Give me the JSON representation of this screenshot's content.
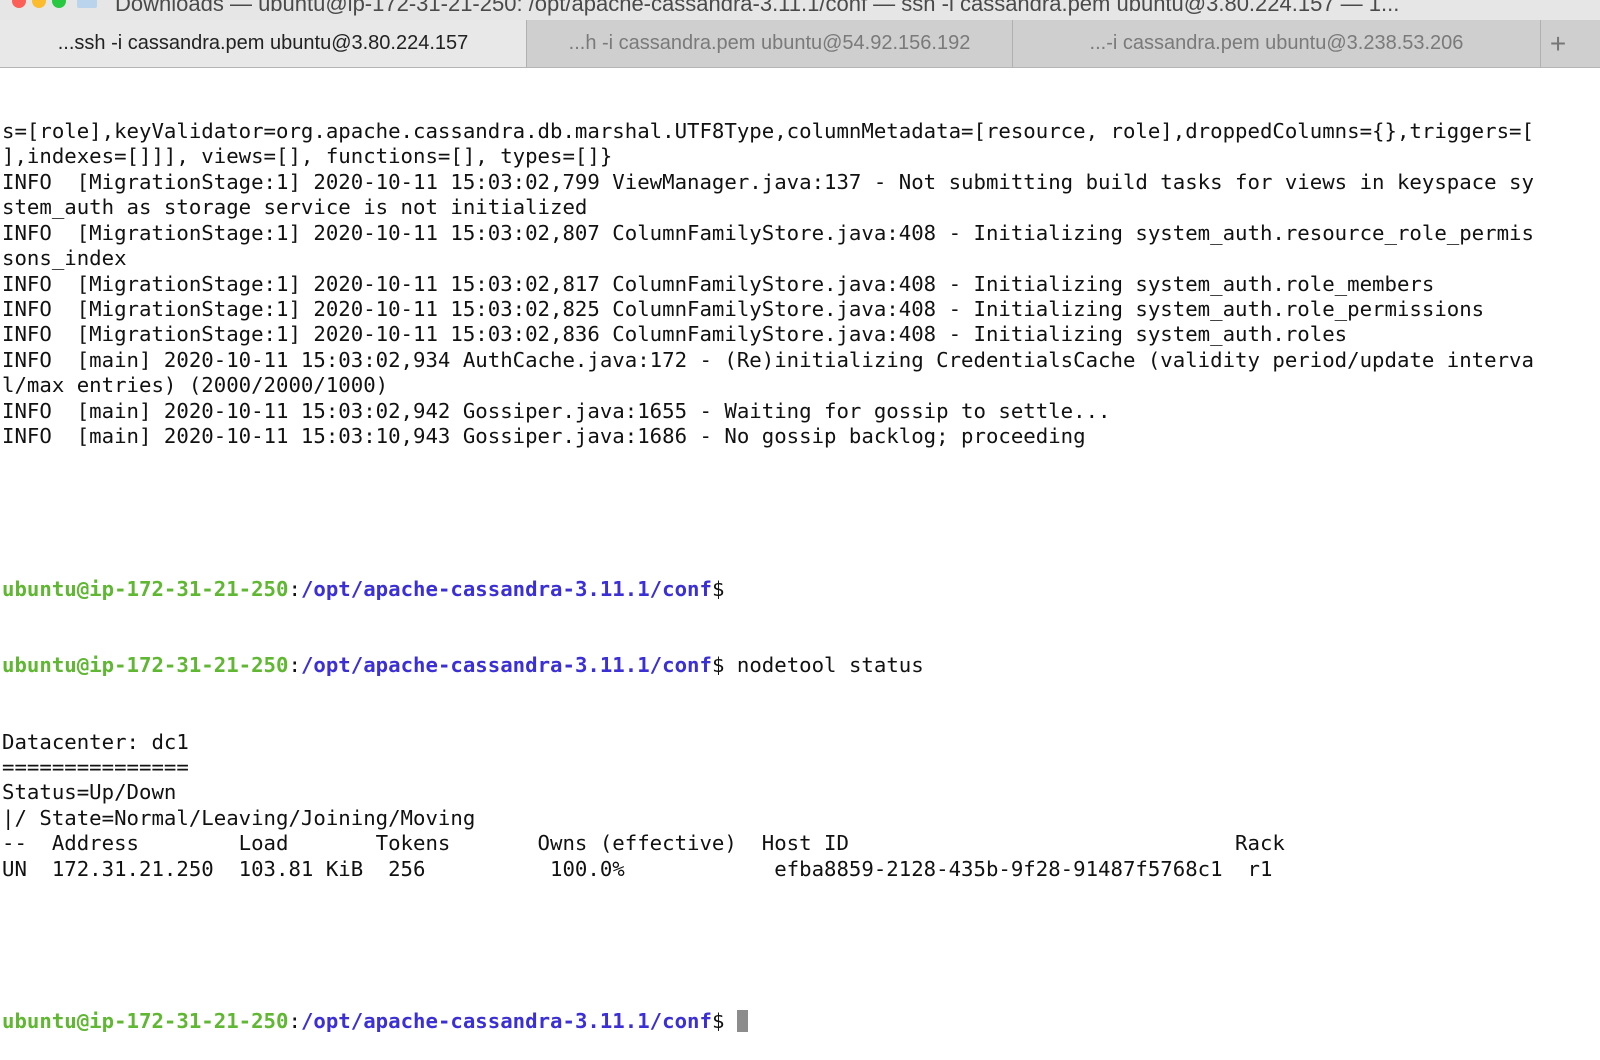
{
  "window": {
    "title": "Downloads — ubuntu@ip-172-31-21-250: /opt/apache-cassandra-3.11.1/conf — ssh -i cassandra.pem ubuntu@3.80.224.157 — 1..."
  },
  "tabs": [
    {
      "label": "...ssh -i cassandra.pem ubuntu@3.80.224.157",
      "active": true
    },
    {
      "label": "...h -i cassandra.pem ubuntu@54.92.156.192",
      "active": false
    },
    {
      "label": "...-i cassandra.pem ubuntu@3.238.53.206",
      "active": false
    }
  ],
  "new_tab_label": "+",
  "log_lines": [
    "s=[role],keyValidator=org.apache.cassandra.db.marshal.UTF8Type,columnMetadata=[resource, role],droppedColumns={},triggers=[",
    "],indexes=[]]], views=[], functions=[], types=[]}",
    "INFO  [MigrationStage:1] 2020-10-11 15:03:02,799 ViewManager.java:137 - Not submitting build tasks for views in keyspace sy",
    "stem_auth as storage service is not initialized",
    "INFO  [MigrationStage:1] 2020-10-11 15:03:02,807 ColumnFamilyStore.java:408 - Initializing system_auth.resource_role_permis",
    "sons_index",
    "INFO  [MigrationStage:1] 2020-10-11 15:03:02,817 ColumnFamilyStore.java:408 - Initializing system_auth.role_members",
    "INFO  [MigrationStage:1] 2020-10-11 15:03:02,825 ColumnFamilyStore.java:408 - Initializing system_auth.role_permissions",
    "INFO  [MigrationStage:1] 2020-10-11 15:03:02,836 ColumnFamilyStore.java:408 - Initializing system_auth.roles",
    "INFO  [main] 2020-10-11 15:03:02,934 AuthCache.java:172 - (Re)initializing CredentialsCache (validity period/update interva",
    "l/max entries) (2000/2000/1000)",
    "INFO  [main] 2020-10-11 15:03:02,942 Gossiper.java:1655 - Waiting for gossip to settle...",
    "INFO  [main] 2020-10-11 15:03:10,943 Gossiper.java:1686 - No gossip backlog; proceeding"
  ],
  "prompt": {
    "user_host": "ubuntu@ip-172-31-21-250",
    "separator": ":",
    "path": "/opt/apache-cassandra-3.11.1/conf",
    "symbol": "$"
  },
  "command": " nodetool status",
  "output_lines": [
    "Datacenter: dc1",
    "===============",
    "Status=Up/Down",
    "|/ State=Normal/Leaving/Joining/Moving",
    "--  Address        Load       Tokens       Owns (effective)  Host ID                               Rack",
    "UN  172.31.21.250  103.81 KiB  256          100.0%            efba8859-2128-435b-9f28-91487f5768c1  r1"
  ],
  "colors": {
    "user_host": "#5fb732",
    "path": "#3b2fd6",
    "cursor": "#8c8c8c"
  }
}
